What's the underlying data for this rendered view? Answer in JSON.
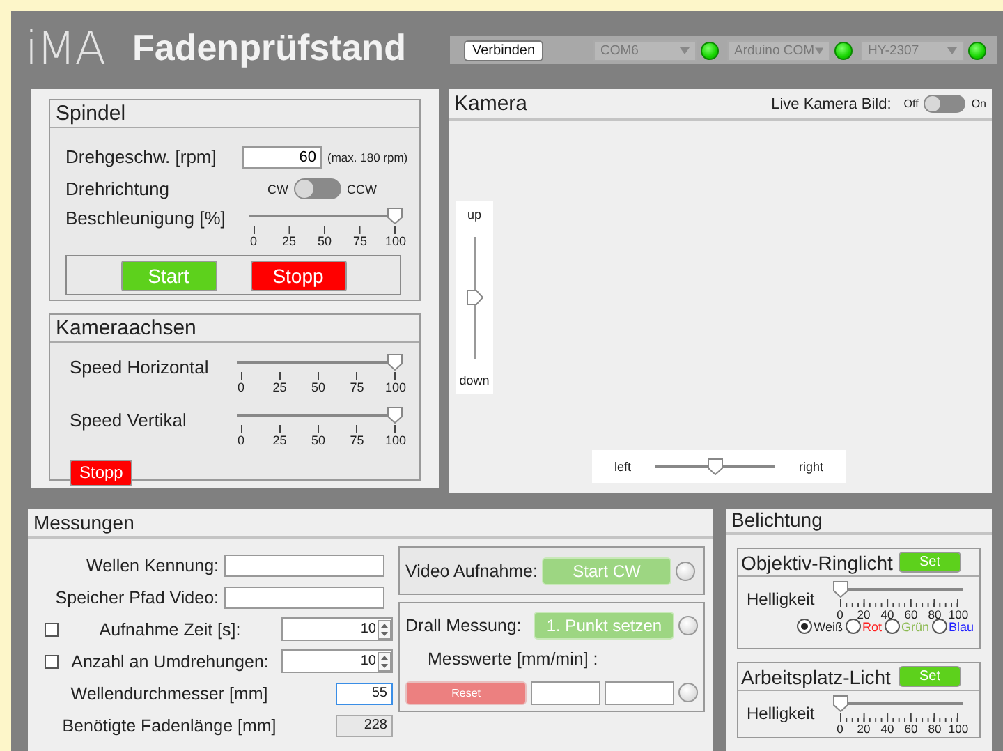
{
  "header": {
    "logo": "iMA",
    "title": "Fadenprüfstand"
  },
  "connection": {
    "button": "Verbinden",
    "ports": [
      {
        "value": "COM6",
        "on": true
      },
      {
        "value": "Arduino COM",
        "on": true
      },
      {
        "value": "HY-2307",
        "on": true
      }
    ]
  },
  "spindel": {
    "title": "Spindel",
    "speed": {
      "label": "Drehgeschw. [rpm]",
      "value": "60",
      "hint": "(max. 180 rpm)"
    },
    "direction": {
      "label": "Drehrichtung",
      "off_label": "CW",
      "on_label": "CCW",
      "on": false
    },
    "accel": {
      "label": "Beschleunigung [%]",
      "level": 1,
      "ticks": [
        "0",
        "25",
        "50",
        "75",
        "100"
      ]
    },
    "buttons": [
      {
        "label": "Start",
        "kind": "start"
      },
      {
        "label": "Stopp",
        "kind": "stop"
      }
    ]
  },
  "kameraachsen": {
    "title": "Kameraachsen",
    "sliders": [
      {
        "label": "Speed Horizontal",
        "level": 1,
        "ticks": [
          "0",
          "25",
          "50",
          "75",
          "100"
        ]
      },
      {
        "label": "Speed Vertikal",
        "level": 1,
        "ticks": [
          "0",
          "25",
          "50",
          "75",
          "100"
        ]
      }
    ],
    "button": "Stopp"
  },
  "kamera": {
    "title": "Kamera",
    "live": {
      "label": "Live Kamera Bild:",
      "off_label": "Off",
      "on_label": "On",
      "on": false
    },
    "vertical": {
      "top_label": "up",
      "bottom_label": "down",
      "level": 0.5
    },
    "horizontal": {
      "left_label": "left",
      "right_label": "right",
      "level": 0.5
    }
  },
  "messungen": {
    "title": "Messungen",
    "fields": [
      {
        "kind": "text",
        "label": "Wellen Kennung:",
        "focused": false
      },
      {
        "kind": "text",
        "label": "Speicher Pfad Video:",
        "focused": false
      },
      {
        "kind": "spin",
        "label": "Aufnahme Zeit [s]:",
        "checked": false,
        "value": "10",
        "focused": false
      },
      {
        "kind": "spin",
        "label": "Anzahl an Umdrehungen:",
        "checked": false,
        "value": "10",
        "focused": false
      },
      {
        "kind": "number",
        "label": "Wellendurchmesser [mm]",
        "value": "55",
        "focused": true
      },
      {
        "kind": "readonly",
        "label": "Benötigte Fadenlänge [mm]",
        "value": "228",
        "focused": false
      }
    ],
    "video": {
      "label": "Video Aufnahme:",
      "button": "Start CW",
      "disabled": true,
      "on": false
    },
    "drall": {
      "label": "Drall Messung:",
      "button": "1. Punkt setzen",
      "disabled": true,
      "on": false,
      "values_label": "Messwerte [mm/min] :",
      "reset": "Reset",
      "reset_disabled": true,
      "values_on": false
    }
  },
  "belichtung": {
    "title": "Belichtung",
    "groups": [
      {
        "title": "Objektiv-Ringlicht",
        "button": "Set",
        "label": "Helligkeit",
        "level": 0,
        "ticks": [
          "0",
          "20",
          "40",
          "60",
          "80",
          "100"
        ],
        "colors": [
          {
            "label": "Weiß",
            "color": "#222222",
            "selected": true
          },
          {
            "label": "Rot",
            "color": "#ff2020",
            "selected": false
          },
          {
            "label": "Grün",
            "color": "#8cba52",
            "selected": false
          },
          {
            "label": "Blau",
            "color": "#2020ff",
            "selected": false
          }
        ]
      },
      {
        "title": "Arbeitsplatz-Licht",
        "button": "Set",
        "label": "Helligkeit",
        "level": 0,
        "ticks": [
          "0",
          "20",
          "40",
          "60",
          "80",
          "100"
        ]
      }
    ]
  }
}
